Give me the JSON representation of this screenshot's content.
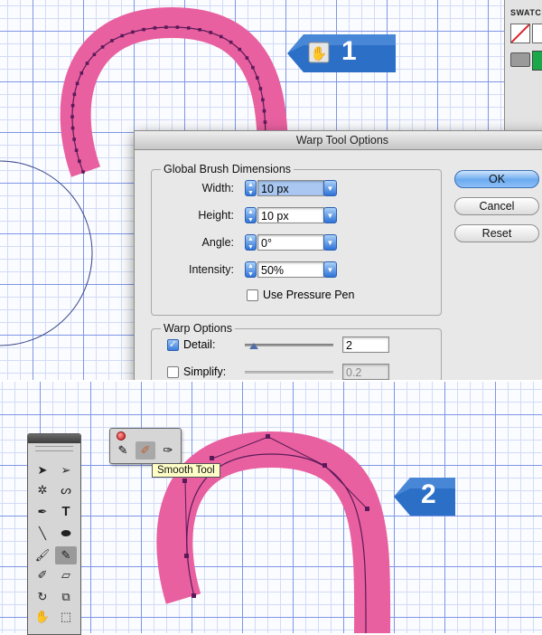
{
  "step_badges": [
    {
      "number": "1",
      "icon": "warp-tool-icon"
    },
    {
      "number": "2"
    }
  ],
  "swatches_panel": {
    "title": "SWATCHES"
  },
  "dialog": {
    "title": "Warp Tool Options",
    "global_brush": {
      "legend": "Global Brush Dimensions",
      "width_label": "Width:",
      "width_value": "10 px",
      "height_label": "Height:",
      "height_value": "10 px",
      "angle_label": "Angle:",
      "angle_value": "0°",
      "intensity_label": "Intensity:",
      "intensity_value": "50%",
      "pressure_label": "Use Pressure Pen",
      "pressure_checked": false
    },
    "warp_options": {
      "legend": "Warp Options",
      "detail_label": "Detail:",
      "detail_checked": true,
      "detail_value": "2",
      "detail_slider_level": 0.1,
      "simplify_label": "Simplify:",
      "simplify_checked": false,
      "simplify_value": "0.2"
    },
    "buttons": {
      "ok": "OK",
      "cancel": "Cancel",
      "reset": "Reset"
    }
  },
  "toolbox": {
    "tools": [
      {
        "icon": "selection-arrow-icon"
      },
      {
        "icon": "direct-selection-icon"
      },
      {
        "icon": "magic-wand-icon"
      },
      {
        "icon": "lasso-icon"
      },
      {
        "icon": "pen-icon"
      },
      {
        "icon": "type-icon",
        "glyph": "T"
      },
      {
        "icon": "line-icon"
      },
      {
        "icon": "ellipse-icon"
      },
      {
        "icon": "paintbrush-icon"
      },
      {
        "icon": "pencil-icon",
        "active": true
      },
      {
        "icon": "blob-brush-icon"
      },
      {
        "icon": "eraser-icon"
      },
      {
        "icon": "rotate-icon"
      },
      {
        "icon": "scale-icon"
      },
      {
        "icon": "warp-icon"
      },
      {
        "icon": "free-transform-icon"
      }
    ]
  },
  "pencil_flyout": {
    "tools": [
      {
        "icon": "pencil-icon"
      },
      {
        "icon": "smooth-tool-icon",
        "active": true
      },
      {
        "icon": "path-eraser-icon"
      }
    ],
    "tooltip": "Smooth Tool"
  },
  "colors": {
    "stroke_pink": "#e8609f",
    "path": "#5a1a5a",
    "badge_blue": "#2b6fc7",
    "grid_major": "#7e96e6",
    "grid_minor": "#d2dbf7"
  }
}
